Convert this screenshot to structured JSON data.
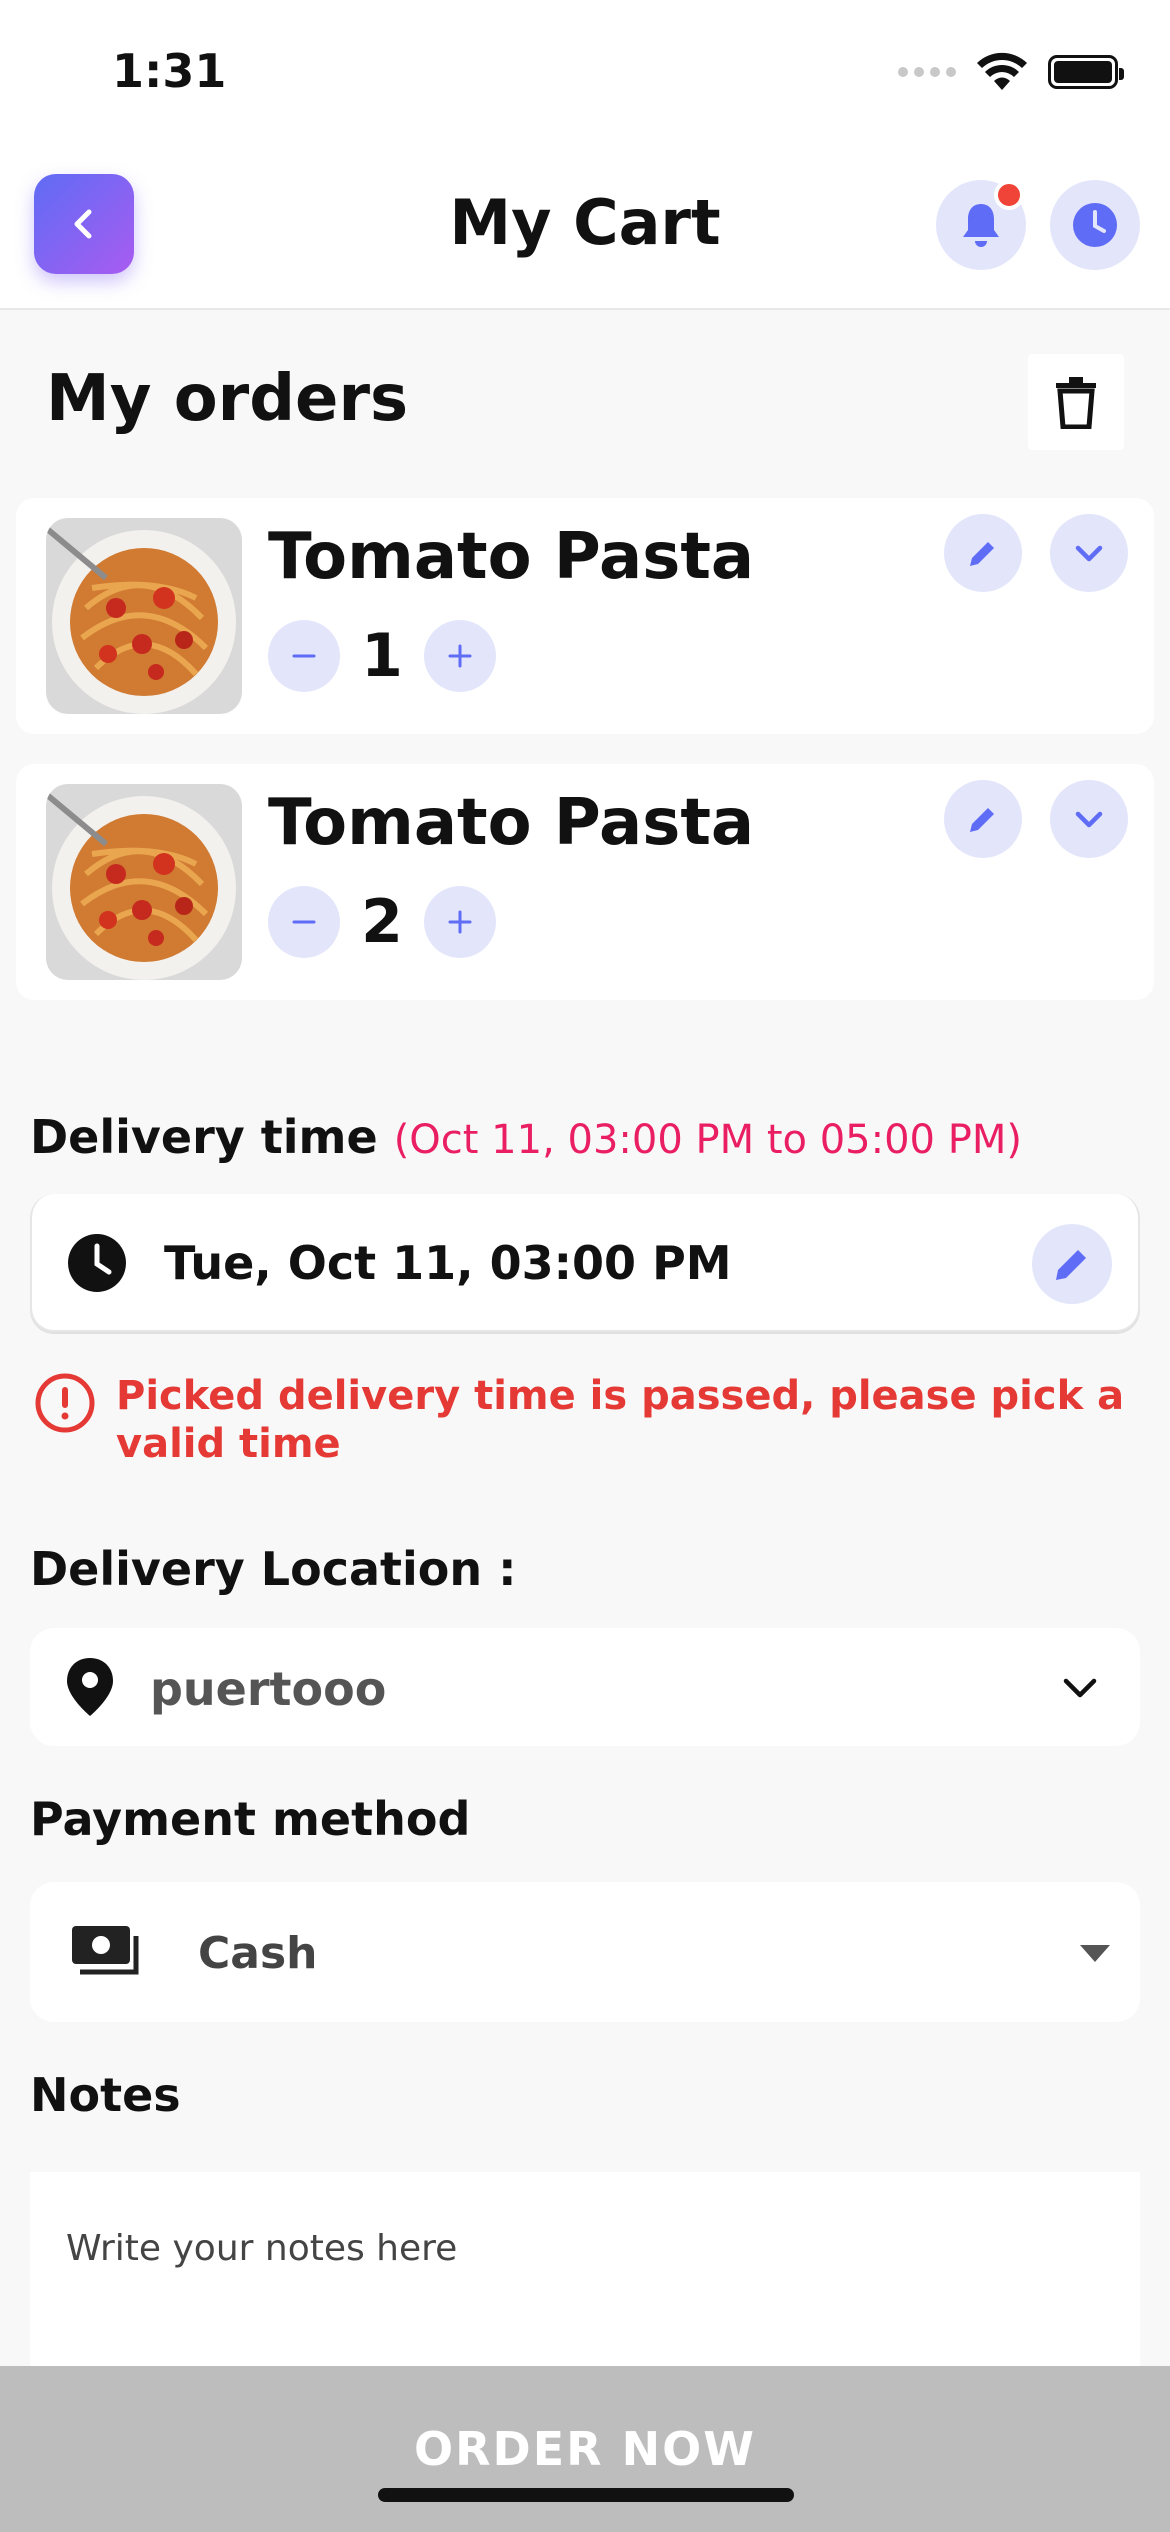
{
  "status_bar": {
    "time": "1:31"
  },
  "header": {
    "title": "My Cart"
  },
  "orders": {
    "title": "My orders",
    "items": [
      {
        "name": "Tomato Pasta",
        "quantity": "1"
      },
      {
        "name": "Tomato Pasta",
        "quantity": "2"
      }
    ]
  },
  "delivery_time": {
    "label": "Delivery time",
    "range": "(Oct 11, 03:00 PM to 05:00 PM)",
    "value": "Tue, Oct 11, 03:00 PM",
    "error": "Picked delivery time is passed, please pick a valid time"
  },
  "delivery_location": {
    "label": "Delivery Location :",
    "value": "puertooo"
  },
  "payment": {
    "label": "Payment method",
    "value": "Cash"
  },
  "notes": {
    "label": "Notes",
    "placeholder": "Write your notes here"
  },
  "order_button": {
    "label": "ORDER NOW"
  },
  "colors": {
    "accent": "#5f6cf5",
    "accent_light": "#e3e5fb",
    "error": "#e53935",
    "range": "#e91e63",
    "disabled_button": "#bdbdbd"
  }
}
